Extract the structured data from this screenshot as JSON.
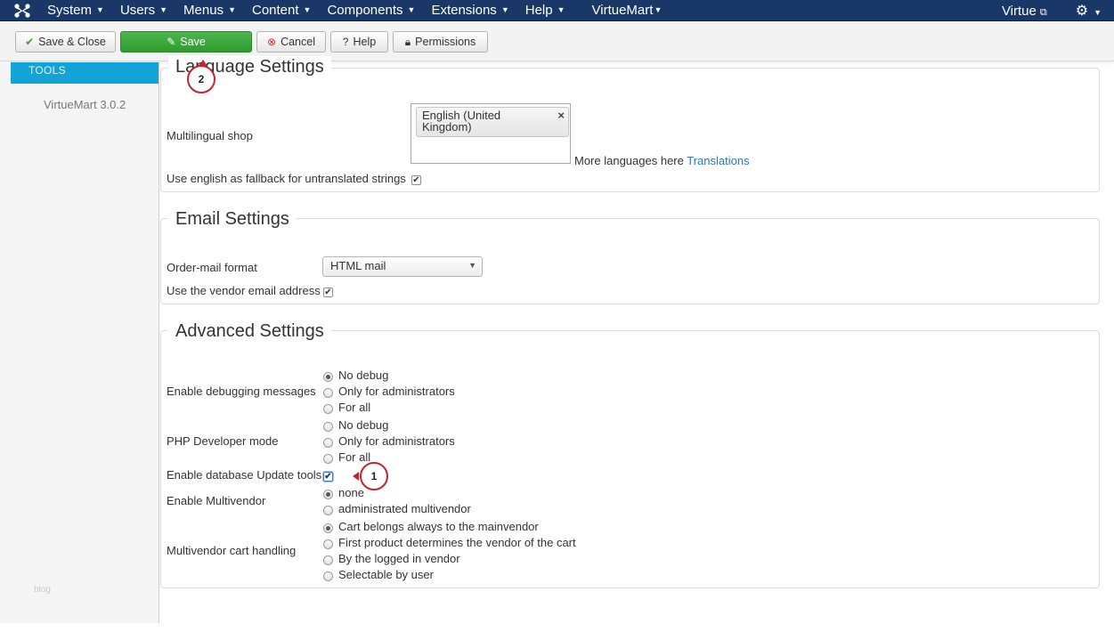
{
  "navbar": {
    "logo_icon": "joomla-logo-icon",
    "menu": [
      {
        "label": "System"
      },
      {
        "label": "Users"
      },
      {
        "label": "Menus"
      },
      {
        "label": "Content"
      },
      {
        "label": "Components"
      },
      {
        "label": "Extensions"
      },
      {
        "label": "Help"
      },
      {
        "label": "VirtueMart"
      }
    ],
    "site_label": "Virtue",
    "colors": {
      "background": "#1a3867",
      "text": "#ffffff"
    }
  },
  "toolbar": {
    "save_close_label": "Save & Close",
    "save_label": "Save",
    "cancel_label": "Cancel",
    "help_label": "Help",
    "permissions_label": "Permissions",
    "colors": {
      "save_primary": "#3aa83a"
    }
  },
  "sidebar": {
    "active_item": "TOOLS",
    "version": "VirtueMart 3.0.2",
    "footer_link": "blog",
    "colors": {
      "active_background": "#12a3d7"
    }
  },
  "language_settings": {
    "legend": "Language Settings",
    "multilingual_label": "Multilingual shop",
    "selected_language": "English (United Kingdom)",
    "more_languages_text": "More languages here",
    "translations_link": "Translations",
    "fallback_label": "Use english as fallback for untranslated strings",
    "fallback_checked": true
  },
  "email_settings": {
    "legend": "Email Settings",
    "order_mail_format_label": "Order-mail format",
    "order_mail_format_value": "HTML mail",
    "vendor_email_label": "Use the vendor email address",
    "vendor_email_checked": true
  },
  "advanced_settings": {
    "legend": "Advanced Settings",
    "debugging": {
      "label": "Enable debugging messages",
      "options": [
        "No debug",
        "Only for administrators",
        "For all"
      ],
      "selected": "No debug"
    },
    "php_developer": {
      "label": "PHP Developer mode",
      "options": [
        "No debug",
        "Only for administrators",
        "For all"
      ],
      "selected": ""
    },
    "db_update_tools": {
      "label": "Enable database Update tools",
      "checked": true
    },
    "multivendor": {
      "label": "Enable Multivendor",
      "options": [
        "none",
        "administrated multivendor"
      ],
      "selected": "none"
    },
    "multivendor_cart": {
      "label": "Multivendor cart handling",
      "options": [
        "Cart belongs always to the mainvendor",
        "First product determines the vendor of the cart",
        "By the logged in vendor",
        "Selectable by user"
      ],
      "selected": "Cart belongs always to the mainvendor"
    }
  },
  "annotations": [
    {
      "number": "1",
      "target": "db-update-tools-checkbox"
    },
    {
      "number": "2",
      "target": "save-button"
    }
  ]
}
